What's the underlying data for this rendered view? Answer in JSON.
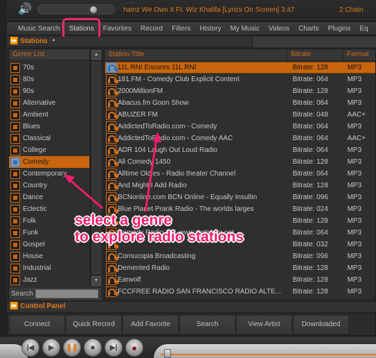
{
  "player": {
    "volume_icon": "speaker-icon",
    "now_playing": "hainz We Own It Ft. Wiz Khalifa [Lyrics On Screen]  3:47",
    "now_playing_next": "2 Chain"
  },
  "menu": {
    "items": [
      {
        "label": "Music Search"
      },
      {
        "label": "Stations",
        "active": true
      },
      {
        "label": "Favorites"
      },
      {
        "label": "Record"
      },
      {
        "label": "Filters"
      },
      {
        "label": "History"
      },
      {
        "label": "My Music"
      },
      {
        "label": "Videos"
      },
      {
        "label": "Charts"
      },
      {
        "label": "Plugins"
      },
      {
        "label": "Eq"
      }
    ]
  },
  "stations_section": {
    "title": "Stations",
    "marker": "•"
  },
  "genres": {
    "header": "Genre List",
    "selected": "Comedy",
    "items": [
      "70s",
      "80s",
      "90s",
      "Alternative",
      "Ambient",
      "Blues",
      "Classical",
      "College",
      "Comedy",
      "Contemporary",
      "Country",
      "Dance",
      "Eclectic",
      "Folk",
      "Funk",
      "Gospel",
      "House",
      "Industrial",
      "Jazz"
    ],
    "search_label": "Search",
    "search_value": ""
  },
  "stations_table": {
    "columns": {
      "title": "Station Title",
      "bitrate": "Bitrate",
      "format": "Format"
    },
    "rows": [
      {
        "title": "11L RNI Encores 11L RNI",
        "bitrate": "Bitrate: 128",
        "format": "MP3",
        "selected": true
      },
      {
        "title": "181.FM - Comedy Club Explicit Content",
        "bitrate": "Bitrate: 064",
        "format": "MP3"
      },
      {
        "title": "2000MillionFM",
        "bitrate": "Bitrate: 128",
        "format": "MP3"
      },
      {
        "title": "Abacus.fm Goon Show",
        "bitrate": "Bitrate: 064",
        "format": "MP3"
      },
      {
        "title": "ABUZER FM",
        "bitrate": "Bitrate: 048",
        "format": "AAC+"
      },
      {
        "title": "AddictedToRadio.com - Comedy",
        "bitrate": "Bitrate: 064",
        "format": "MP3"
      },
      {
        "title": "AddictedToRadio.com - Comedy AAC",
        "bitrate": "Bitrate: 064",
        "format": "AAC+"
      },
      {
        "title": "ADR 104 Laugh Out Loud Radio",
        "bitrate": "Bitrate: 064",
        "format": "MP3"
      },
      {
        "title": "All Comedy 1450",
        "bitrate": "Bitrate: 128",
        "format": "MP3"
      },
      {
        "title": "Alltime Oldies - Radio theater Channel",
        "bitrate": "Bitrate: 064",
        "format": "MP3"
      },
      {
        "title": "And Might I Add Radio",
        "bitrate": "Bitrate: 128",
        "format": "MP3"
      },
      {
        "title": "BCNonline.com BCN Online - Equally Insultin",
        "bitrate": "Bitrate: 096",
        "format": "MP3"
      },
      {
        "title": "Blue Planet Prank Radio - The worlds larges",
        "bitrate": "Bitrate: 024",
        "format": "MP3"
      },
      {
        "title": "",
        "bitrate": "Bitrate: 128",
        "format": "MP3"
      },
      {
        "title": "Comedy Radio 101 www.mptradio.net",
        "bitrate": "Bitrate: 064",
        "format": "MP3"
      },
      {
        "title": "",
        "bitrate": "Bitrate: 032",
        "format": "MP3"
      },
      {
        "title": "Cornucopia Broadcasting",
        "bitrate": "Bitrate: 096",
        "format": "MP3"
      },
      {
        "title": "Demented Radio",
        "bitrate": "Bitrate: 128",
        "format": "MP3"
      },
      {
        "title": "Earwolf",
        "bitrate": "Bitrate: 128",
        "format": "MP3"
      },
      {
        "title": "FCCFREE RADIO SAN FRANCISCO RADIO ALTE...",
        "bitrate": "Bitrate: 128",
        "format": "MP3"
      }
    ]
  },
  "annotation": {
    "line1": "select a genre",
    "line2": "to explore radio stations",
    "color": "#f21d6b"
  },
  "control_panel": {
    "title": "Control Panel",
    "buttons": [
      "Connect",
      "Quick Record",
      "Add Favorite",
      "Search",
      "View Artist",
      "Downloaded"
    ]
  },
  "transport": {
    "buttons": [
      {
        "name": "previous",
        "glyph": "|◀"
      },
      {
        "name": "play",
        "glyph": "▶"
      },
      {
        "name": "pause",
        "glyph": "❚❚"
      },
      {
        "name": "stop",
        "glyph": "■"
      },
      {
        "name": "next",
        "glyph": "▶|"
      },
      {
        "name": "record",
        "glyph": "●"
      }
    ],
    "seek_position": 0.01
  },
  "colors": {
    "accent": "#e07a1c",
    "selection": "#c9650f",
    "highlight_box": "#f0286a"
  }
}
